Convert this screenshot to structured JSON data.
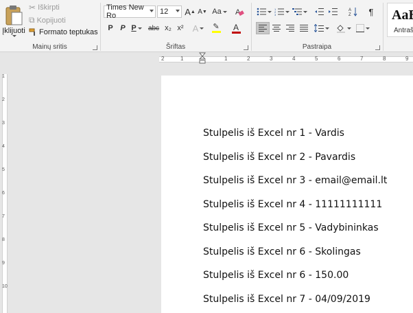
{
  "ribbon": {
    "clipboard": {
      "paste_label": "Įklijuoti",
      "cut_label": "Iškirpti",
      "copy_label": "Kopijuoti",
      "format_painter_label": "Formato teptukas",
      "group_label": "Mainų sritis"
    },
    "font": {
      "font_name": "Times New Ro",
      "font_size": "12",
      "group_label": "Šriftas",
      "bold": "P",
      "italic": "P",
      "underline": "P",
      "strike": "abc",
      "subscript": "x₂",
      "superscript": "x²",
      "grow": "A",
      "shrink": "A",
      "change_case": "Aa",
      "font_color": "A",
      "effects": "A"
    },
    "paragraph": {
      "group_label": "Pastraipa",
      "show_marks": "¶"
    },
    "styles": {
      "sample": "AaB",
      "name": "Antraš"
    }
  },
  "ruler": {
    "horizontal_ticks": [
      "2",
      "1",
      "1",
      "2",
      "3",
      "4",
      "5",
      "6",
      "7",
      "8",
      "9"
    ],
    "vertical_ticks": [
      "1",
      "2",
      "3",
      "4",
      "5",
      "6",
      "7",
      "8",
      "9",
      "10"
    ]
  },
  "document": {
    "lines": [
      "Stulpelis iš Excel nr 1 - Vardis",
      "Stulpelis iš Excel nr 2 - Pavardis",
      "Stulpelis iš Excel nr 3 - email@email.lt",
      "Stulpelis iš Excel nr 4 - 11111111111",
      "Stulpelis iš Excel nr 5 - Vadybininkas",
      "Stulpelis iš Excel nr 6 - Skolingas",
      "Stulpelis iš Excel nr 6 - 150.00",
      "Stulpelis iš Excel nr 7 - 04/09/2019"
    ]
  },
  "colors": {
    "ribbon_bg": "#f3f3f3",
    "workspace_bg": "#e6e6e6",
    "page_bg": "#ffffff",
    "font_color_bar": "#c00000",
    "highlight_bar": "#ffff00",
    "clipboard_icon": "#c8a15a"
  }
}
